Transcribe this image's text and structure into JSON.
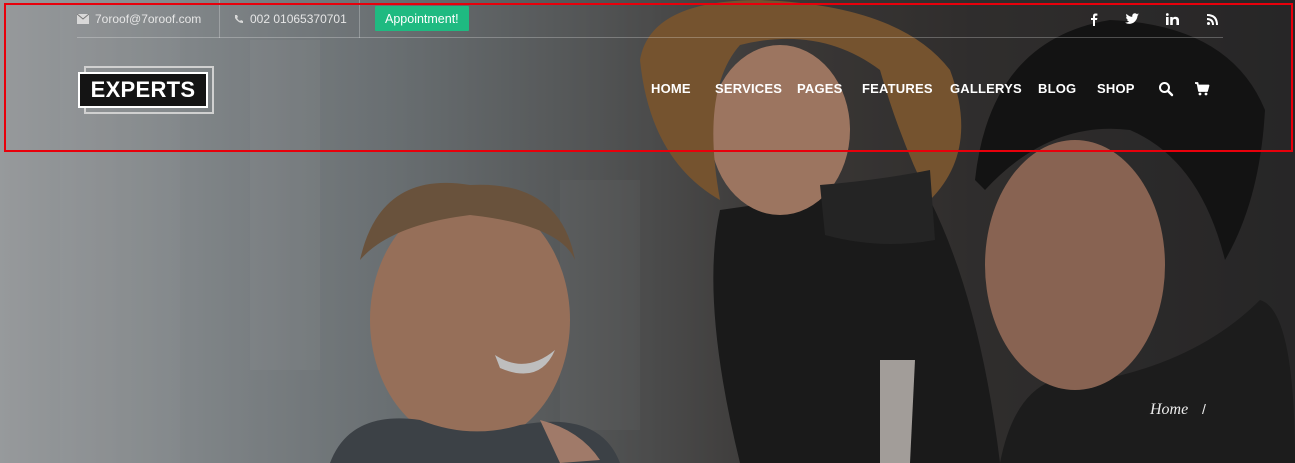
{
  "topbar": {
    "email": "7oroof@7oroof.com",
    "phone": "002 01065370701",
    "appointment_label": "Appointment!",
    "social": [
      {
        "icon": "facebook-icon",
        "glyph": "f"
      },
      {
        "icon": "twitter-icon",
        "glyph": "t"
      },
      {
        "icon": "linkedin-icon",
        "glyph": "in"
      },
      {
        "icon": "rss-icon",
        "glyph": "rss"
      }
    ]
  },
  "logo": {
    "text": "EXPERTS"
  },
  "nav": {
    "items": [
      "HOME",
      "SERVICES",
      "PAGES",
      "FEATURES",
      "GALLERYS",
      "BLOG",
      "SHOP"
    ],
    "search_icon": "search-icon",
    "cart_icon": "cart-icon"
  },
  "breadcrumb": {
    "home": "Home",
    "separator": "/"
  },
  "colors": {
    "accent": "#1fba81",
    "highlight_box": "#e8000b",
    "logo_bg": "#141414"
  }
}
